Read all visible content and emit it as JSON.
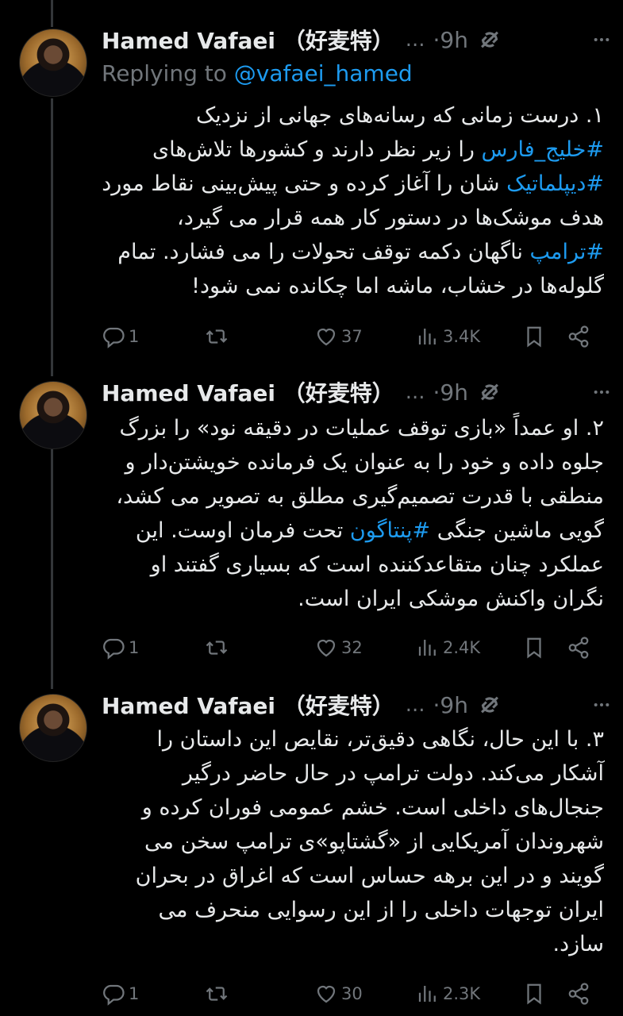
{
  "colors": {
    "background": "#000000",
    "text": "#e7e9ea",
    "muted": "#71767b",
    "link": "#1d9bf0"
  },
  "tweets": [
    {
      "author": "Hamed Vafaei （好麦特）",
      "separator": "...",
      "time": "·9h",
      "replying_prefix": "Replying to",
      "replying_handle": "@vafaei_hamed",
      "body": [
        {
          "t": "۱. درست زمانی که رسانه‌های جهانی از نزدیک "
        },
        {
          "t": "#خلیج_فارس",
          "tag": true
        },
        {
          "t": " را زیر نظر دارند و کشورها تلاش‌های "
        },
        {
          "t": "#دیپلماتیک",
          "tag": true
        },
        {
          "t": " شان را آغاز کرده و حتی پیش‌بینی نقاط مورد هدف موشک‌ها در دستور کار همه قرار می گیرد، "
        },
        {
          "t": "#ترامپ",
          "tag": true
        },
        {
          "t": " ناگهان دکمه توقف تحولات را می فشارد. تمام گلوله‌ها در خشاب، ماشه اما چکانده نمی شود!"
        }
      ],
      "replies": "1",
      "likes": "37",
      "views": "3.4K"
    },
    {
      "author": "Hamed Vafaei （好麦特）",
      "separator": "...",
      "time": "·9h",
      "body": [
        {
          "t": "۲. او عمداً «بازی توقف عملیات در دقیقه نود» را بزرگ جلوه داده و خود را به عنوان یک فرمانده خویشتن‌دار و منطقی با قدرت تصمیم‌گیری مطلق به تصویر می کشد، گویی ماشین جنگی "
        },
        {
          "t": "#پنتاگون",
          "tag": true
        },
        {
          "t": " تحت فرمان اوست. این عملکرد چنان متقاعدکننده است که بسیاری گفتند او نگران واکنش موشکی ایران است."
        }
      ],
      "replies": "1",
      "likes": "32",
      "views": "2.4K"
    },
    {
      "author": "Hamed Vafaei （好麦特）",
      "separator": "...",
      "time": "·9h",
      "body": [
        {
          "t": "۳. با این حال، نگاهی دقیق‌تر، نقایص این داستان را آشکار می‌کند. دولت ترامپ در حال حاضر درگیر جنجال‌های داخلی است. خشم عمومی فوران کرده و شهروندان آمریکایی از «گشتاپو»ی ترامپ سخن می گویند و در این برهه حساس است که اغراق در بحران ایران توجهات داخلی را از این رسوایی منحرف می سازد."
        }
      ],
      "replies": "1",
      "likes": "30",
      "views": "2.3K"
    }
  ]
}
